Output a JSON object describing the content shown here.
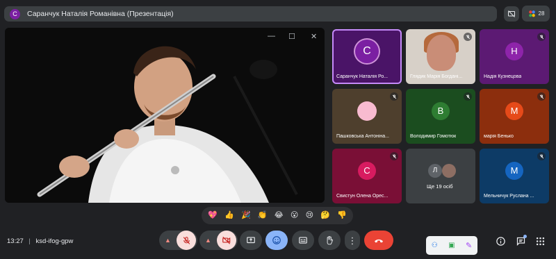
{
  "meeting": {
    "presenter_initial": "С",
    "presentation_title": "Саранчук Наталія Романівна (Презентація)",
    "participant_count": "28",
    "time": "13:27",
    "separator": "|",
    "code": "ksd-ifog-gpw"
  },
  "tiles": [
    {
      "name": "Саранчук Наталія Ро...",
      "initial": "С",
      "color": "#7b1fa2",
      "bg": "#4a1467",
      "muted": false,
      "speaking": true
    },
    {
      "name": "Глядик Марія Богдані...",
      "initial": "",
      "color": "#bdbdbd",
      "bg": "#d7d0c8",
      "muted": true,
      "photo": true
    },
    {
      "name": "Надія Кузнецова",
      "initial": "Н",
      "color": "#8e24aa",
      "bg": "#5c1a73",
      "muted": true
    },
    {
      "name": "Пашковська Антоніна...",
      "initial": "",
      "color": "#f8bbd0",
      "bg": "#4e3f2d",
      "muted": true,
      "photo_small": true
    },
    {
      "name": "Володимир Гомотюк",
      "initial": "В",
      "color": "#2e7d32",
      "bg": "#1b4d1f",
      "muted": true
    },
    {
      "name": "марія Бенько",
      "initial": "М",
      "color": "#e64a19",
      "bg": "#8c2e0d",
      "muted": true
    },
    {
      "name": "Свистун Олена Орес...",
      "initial": "С",
      "color": "#d81b60",
      "bg": "#7a0f36",
      "muted": true
    },
    {
      "name": "Ще 19 осіб",
      "initial": "Л",
      "color": "#5f6368",
      "bg": "#3c4043",
      "muted": false,
      "more": true
    },
    {
      "name": "Мельничук Руслана ...",
      "initial": "М",
      "color": "#1565c0",
      "bg": "#0d3b66",
      "muted": true
    }
  ],
  "reactions": [
    "💖",
    "👍",
    "🎉",
    "👏",
    "😂",
    "😮",
    "😢",
    "🤔",
    "👎"
  ],
  "controls": {
    "mic": "mic-off-icon",
    "camera": "camera-off-icon",
    "present": "present-icon",
    "emoji": "emoji-icon",
    "captions": "captions-icon",
    "hand": "raise-hand-icon",
    "more": "more-vert-icon",
    "leave": "call-end-icon"
  },
  "colors": {
    "danger": "#f28b82",
    "danger_fill": "#ea4335",
    "accent": "#8ab4f8"
  }
}
